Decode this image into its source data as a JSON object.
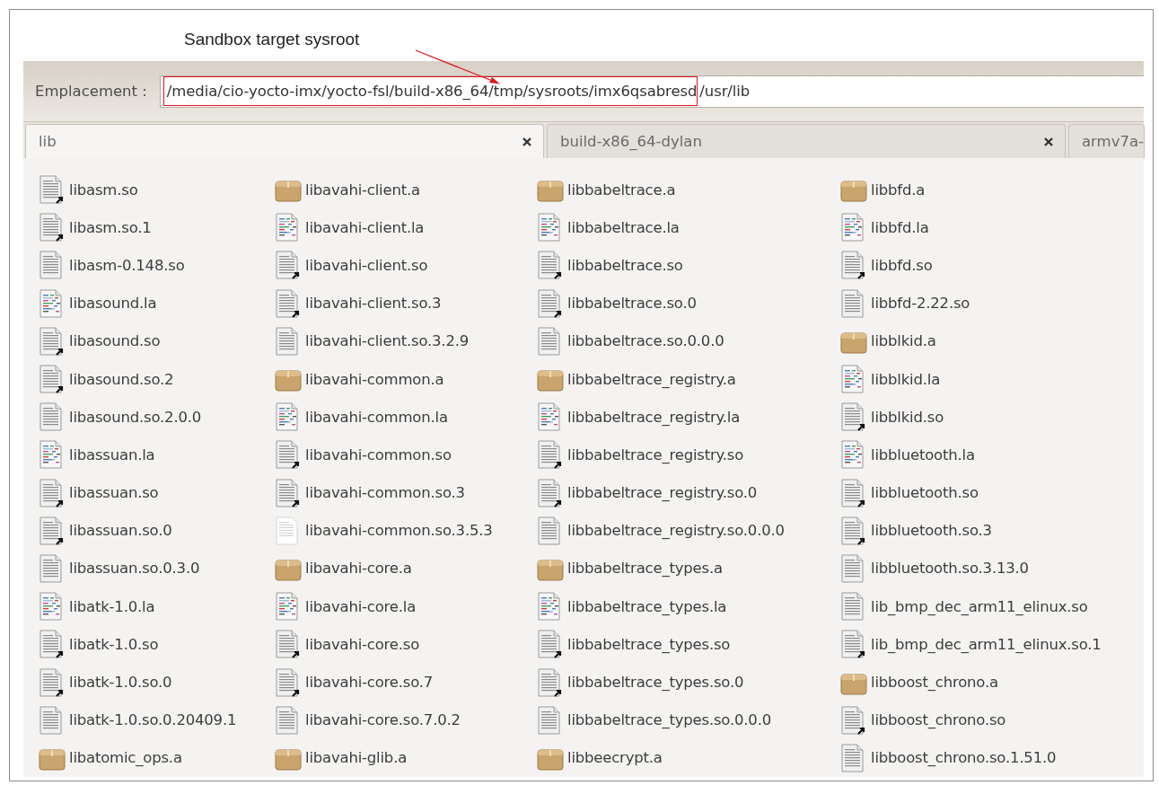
{
  "annotation": {
    "text": "Sandbox target sysroot"
  },
  "location_bar": {
    "label": "Emplacement :",
    "path": [
      {
        "text": "/media/cio-yocto-imx/yocto-fsl/build-x86_64/tmp/sysroots/imx6qsabresd",
        "highlighted": true
      },
      {
        "text": "/usr/lib",
        "highlighted": false
      }
    ]
  },
  "tabs": [
    {
      "label": "lib",
      "selected": true,
      "closable": true
    },
    {
      "label": "build-x86_64-dylan",
      "selected": false,
      "closable": true
    },
    {
      "label": "armv7a-",
      "selected": false,
      "closable": false
    }
  ],
  "files": [
    {
      "name": "libasm.so",
      "kind": "link"
    },
    {
      "name": "libasm.so.1",
      "kind": "link"
    },
    {
      "name": "libasm-0.148.so",
      "kind": "binary"
    },
    {
      "name": "libasound.la",
      "kind": "script"
    },
    {
      "name": "libasound.so",
      "kind": "link"
    },
    {
      "name": "libasound.so.2",
      "kind": "link"
    },
    {
      "name": "libasound.so.2.0.0",
      "kind": "binary"
    },
    {
      "name": "libassuan.la",
      "kind": "script"
    },
    {
      "name": "libassuan.so",
      "kind": "link"
    },
    {
      "name": "libassuan.so.0",
      "kind": "link"
    },
    {
      "name": "libassuan.so.0.3.0",
      "kind": "binary"
    },
    {
      "name": "libatk-1.0.la",
      "kind": "script"
    },
    {
      "name": "libatk-1.0.so",
      "kind": "link"
    },
    {
      "name": "libatk-1.0.so.0",
      "kind": "link"
    },
    {
      "name": "libatk-1.0.so.0.20409.1",
      "kind": "binary"
    },
    {
      "name": "libatomic_ops.a",
      "kind": "archive"
    },
    {
      "name": "libavahi-client.a",
      "kind": "archive"
    },
    {
      "name": "libavahi-client.la",
      "kind": "script"
    },
    {
      "name": "libavahi-client.so",
      "kind": "link"
    },
    {
      "name": "libavahi-client.so.3",
      "kind": "link"
    },
    {
      "name": "libavahi-client.so.3.2.9",
      "kind": "binary"
    },
    {
      "name": "libavahi-common.a",
      "kind": "archive"
    },
    {
      "name": "libavahi-common.la",
      "kind": "script"
    },
    {
      "name": "libavahi-common.so",
      "kind": "link"
    },
    {
      "name": "libavahi-common.so.3",
      "kind": "link"
    },
    {
      "name": "libavahi-common.so.3.5.3",
      "kind": "text"
    },
    {
      "name": "libavahi-core.a",
      "kind": "archive"
    },
    {
      "name": "libavahi-core.la",
      "kind": "script"
    },
    {
      "name": "libavahi-core.so",
      "kind": "link"
    },
    {
      "name": "libavahi-core.so.7",
      "kind": "link"
    },
    {
      "name": "libavahi-core.so.7.0.2",
      "kind": "binary"
    },
    {
      "name": "libavahi-glib.a",
      "kind": "archive"
    },
    {
      "name": "libbabeltrace.a",
      "kind": "archive"
    },
    {
      "name": "libbabeltrace.la",
      "kind": "script"
    },
    {
      "name": "libbabeltrace.so",
      "kind": "link"
    },
    {
      "name": "libbabeltrace.so.0",
      "kind": "link"
    },
    {
      "name": "libbabeltrace.so.0.0.0",
      "kind": "binary"
    },
    {
      "name": "libbabeltrace_registry.a",
      "kind": "archive"
    },
    {
      "name": "libbabeltrace_registry.la",
      "kind": "script"
    },
    {
      "name": "libbabeltrace_registry.so",
      "kind": "link"
    },
    {
      "name": "libbabeltrace_registry.so.0",
      "kind": "link"
    },
    {
      "name": "libbabeltrace_registry.so.0.0.0",
      "kind": "binary"
    },
    {
      "name": "libbabeltrace_types.a",
      "kind": "archive"
    },
    {
      "name": "libbabeltrace_types.la",
      "kind": "script"
    },
    {
      "name": "libbabeltrace_types.so",
      "kind": "link"
    },
    {
      "name": "libbabeltrace_types.so.0",
      "kind": "link"
    },
    {
      "name": "libbabeltrace_types.so.0.0.0",
      "kind": "binary"
    },
    {
      "name": "libbeecrypt.a",
      "kind": "archive"
    },
    {
      "name": "libbfd.a",
      "kind": "archive"
    },
    {
      "name": "libbfd.la",
      "kind": "script"
    },
    {
      "name": "libbfd.so",
      "kind": "link"
    },
    {
      "name": "libbfd-2.22.so",
      "kind": "binary"
    },
    {
      "name": "libblkid.a",
      "kind": "archive"
    },
    {
      "name": "libblkid.la",
      "kind": "script"
    },
    {
      "name": "libblkid.so",
      "kind": "link"
    },
    {
      "name": "libbluetooth.la",
      "kind": "script"
    },
    {
      "name": "libbluetooth.so",
      "kind": "link"
    },
    {
      "name": "libbluetooth.so.3",
      "kind": "link"
    },
    {
      "name": "libbluetooth.so.3.13.0",
      "kind": "binary"
    },
    {
      "name": "lib_bmp_dec_arm11_elinux.so",
      "kind": "binary"
    },
    {
      "name": "lib_bmp_dec_arm11_elinux.so.1",
      "kind": "link"
    },
    {
      "name": "libboost_chrono.a",
      "kind": "archive"
    },
    {
      "name": "libboost_chrono.so",
      "kind": "link"
    },
    {
      "name": "libboost_chrono.so.1.51.0",
      "kind": "binary"
    }
  ]
}
